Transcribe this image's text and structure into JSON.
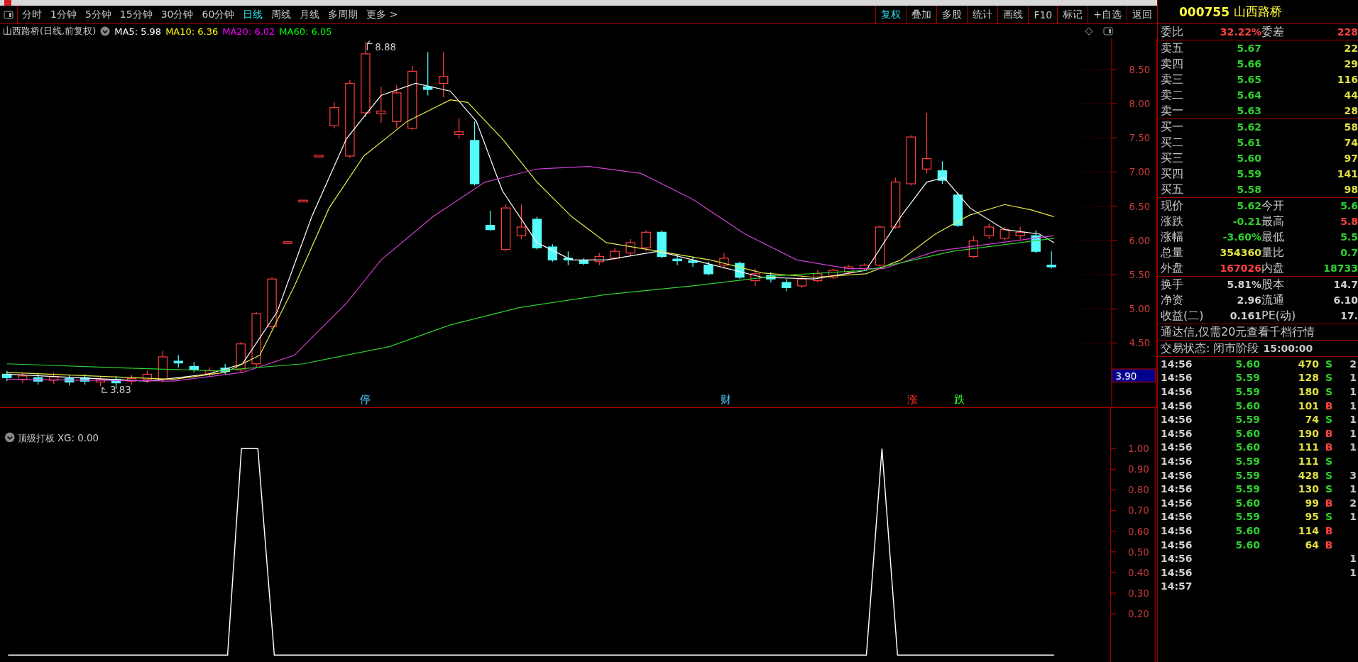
{
  "toolbar": {
    "tabs": [
      {
        "label": "分时",
        "selected": false
      },
      {
        "label": "1分钟",
        "selected": false
      },
      {
        "label": "5分钟",
        "selected": false
      },
      {
        "label": "15分钟",
        "selected": false
      },
      {
        "label": "30分钟",
        "selected": false
      },
      {
        "label": "60分钟",
        "selected": false
      },
      {
        "label": "日线",
        "selected": true
      },
      {
        "label": "周线",
        "selected": false
      },
      {
        "label": "月线",
        "selected": false
      },
      {
        "label": "多周期",
        "selected": false
      },
      {
        "label": "更多 >",
        "selected": false
      }
    ],
    "buttons": [
      {
        "label": "复权",
        "selected": true
      },
      {
        "label": "叠加",
        "selected": false
      },
      {
        "label": "多股",
        "selected": false
      },
      {
        "label": "统计",
        "selected": false
      },
      {
        "label": "画线",
        "selected": false
      },
      {
        "label": "F10",
        "selected": false
      },
      {
        "label": "标记",
        "selected": false
      },
      {
        "label": "+自选",
        "selected": false
      },
      {
        "label": "返回",
        "selected": false
      }
    ]
  },
  "legend": {
    "title": "山西路桥(日线,前复权)",
    "mas": [
      {
        "label": "MA5: 5.98",
        "color": "#ffffff"
      },
      {
        "label": "MA10: 6.36",
        "color": "#ffff00"
      },
      {
        "label": "MA20: 6.02",
        "color": "#ff00ff"
      },
      {
        "label": "MA60: 6.05",
        "color": "#00ff00"
      }
    ]
  },
  "price_chart": {
    "high_label": "8.88",
    "low_label": "3.83",
    "axis": [
      "8.50",
      "8.00",
      "7.50",
      "7.00",
      "6.50",
      "6.00",
      "5.50",
      "5.00",
      "4.50"
    ],
    "current_marker": "3.90",
    "events": [
      {
        "label": "停",
        "color": "#55ccff"
      },
      {
        "label": "财",
        "color": "#55ccff"
      },
      {
        "label": "涨",
        "color": "#ff3030"
      },
      {
        "label": "跌",
        "color": "#30ff30"
      }
    ]
  },
  "indicator": {
    "legend": "顶级打板 XG: 0.00",
    "axis": [
      "1.00",
      "0.90",
      "0.80",
      "0.70",
      "0.60",
      "0.50",
      "0.40",
      "0.30",
      "0.20"
    ]
  },
  "quote": {
    "code": "000755",
    "name": "山西路桥",
    "ratio": {
      "left": {
        "label": "委比",
        "value": "32.22%",
        "color": "#ff4040"
      },
      "right": {
        "label": "委差",
        "value": "228",
        "color": "#ff4040"
      }
    },
    "asks": [
      {
        "label": "卖五",
        "price": "5.67",
        "volume": "22"
      },
      {
        "label": "卖四",
        "price": "5.66",
        "volume": "29"
      },
      {
        "label": "卖三",
        "price": "5.65",
        "volume": "116"
      },
      {
        "label": "卖二",
        "price": "5.64",
        "volume": "44"
      },
      {
        "label": "卖一",
        "price": "5.63",
        "volume": "28"
      }
    ],
    "bids": [
      {
        "label": "买一",
        "price": "5.62",
        "volume": "58"
      },
      {
        "label": "买二",
        "price": "5.61",
        "volume": "74"
      },
      {
        "label": "买三",
        "price": "5.60",
        "volume": "97"
      },
      {
        "label": "买四",
        "price": "5.59",
        "volume": "141"
      },
      {
        "label": "买五",
        "price": "5.58",
        "volume": "98"
      }
    ],
    "stats": [
      {
        "left": {
          "label": "现价",
          "value": "5.62",
          "color": "#2fd02f"
        },
        "right": {
          "label": "今开",
          "value": "5.6",
          "color": "#2fd02f"
        }
      },
      {
        "left": {
          "label": "涨跌",
          "value": "-0.21",
          "color": "#2fd02f"
        },
        "right": {
          "label": "最高",
          "value": "5.8",
          "color": "#ff4040"
        }
      },
      {
        "left": {
          "label": "涨幅",
          "value": "-3.60%",
          "color": "#2fd02f"
        },
        "right": {
          "label": "最低",
          "value": "5.5",
          "color": "#2fd02f"
        }
      },
      {
        "left": {
          "label": "总量",
          "value": "354360",
          "color": "#e0e040"
        },
        "right": {
          "label": "量比",
          "value": "0.7",
          "color": "#2fd02f"
        }
      },
      {
        "left": {
          "label": "外盘",
          "value": "167026",
          "color": "#ff4040"
        },
        "right": {
          "label": "内盘",
          "value": "18733",
          "color": "#2fd02f"
        }
      }
    ],
    "fundamentals": [
      {
        "left": {
          "label": "换手",
          "value": "5.81%"
        },
        "right": {
          "label": "股本",
          "value": "14.7"
        }
      },
      {
        "left": {
          "label": "净资",
          "value": "2.96"
        },
        "right": {
          "label": "流通",
          "value": "6.10"
        }
      },
      {
        "left": {
          "label": "收益(二)",
          "value": "0.161"
        },
        "right": {
          "label": "PE(动)",
          "value": "17."
        }
      }
    ],
    "notice": "通达信,仅需20元查看千档行情",
    "status": {
      "label": "交易状态: 闭市阶段",
      "time": "15:00:00"
    },
    "trades": [
      {
        "time": "14:56",
        "price": "5.60",
        "volume": "470",
        "side": "S",
        "kind": "sell",
        "extra": "2"
      },
      {
        "time": "14:56",
        "price": "5.59",
        "volume": "128",
        "side": "S",
        "kind": "sell",
        "extra": "1"
      },
      {
        "time": "14:56",
        "price": "5.59",
        "volume": "180",
        "side": "S",
        "kind": "sell",
        "extra": "1"
      },
      {
        "time": "14:56",
        "price": "5.60",
        "volume": "101",
        "side": "B",
        "kind": "buy",
        "extra": "1"
      },
      {
        "time": "14:56",
        "price": "5.59",
        "volume": "74",
        "side": "S",
        "kind": "sell",
        "extra": "1"
      },
      {
        "time": "14:56",
        "price": "5.60",
        "volume": "190",
        "side": "B",
        "kind": "buy",
        "extra": "1"
      },
      {
        "time": "14:56",
        "price": "5.60",
        "volume": "111",
        "side": "B",
        "kind": "buy",
        "extra": "1"
      },
      {
        "time": "14:56",
        "price": "5.59",
        "volume": "111",
        "side": "S",
        "kind": "sell"
      },
      {
        "time": "14:56",
        "price": "5.59",
        "volume": "428",
        "side": "S",
        "kind": "sell",
        "extra": "3"
      },
      {
        "time": "14:56",
        "price": "5.59",
        "volume": "130",
        "side": "S",
        "kind": "sell",
        "extra": "1"
      },
      {
        "time": "14:56",
        "price": "5.60",
        "volume": "99",
        "side": "B",
        "kind": "buy",
        "extra": "2"
      },
      {
        "time": "14:56",
        "price": "5.59",
        "volume": "95",
        "side": "S",
        "kind": "sell",
        "extra": "1"
      },
      {
        "time": "14:56",
        "price": "5.60",
        "volume": "114",
        "side": "B",
        "kind": "buy"
      },
      {
        "time": "14:56",
        "price": "5.60",
        "volume": "64",
        "side": "B",
        "kind": "buy"
      },
      {
        "time": "14:56",
        "extra": "1"
      },
      {
        "time": "14:56",
        "extra": "1"
      },
      {
        "time": "14:57"
      }
    ]
  }
}
